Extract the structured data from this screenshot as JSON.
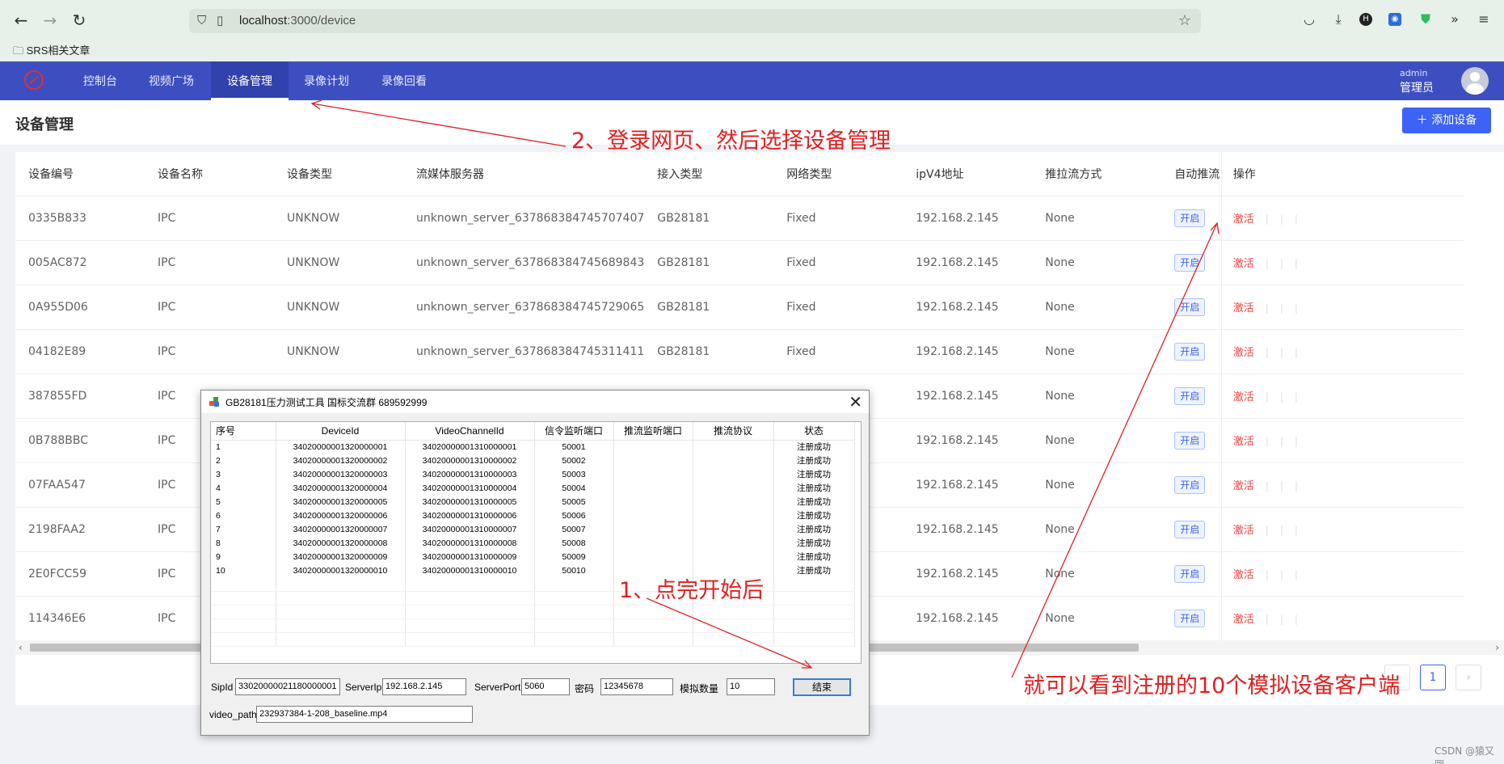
{
  "browser": {
    "url_host": "localhost",
    "url_path": ":3000/device",
    "bookmark": "SRS相关文章"
  },
  "app": {
    "menu": [
      "控制台",
      "视频广场",
      "设备管理",
      "录像计划",
      "录像回看"
    ],
    "active_menu": "设备管理",
    "user_name": "admin",
    "user_role": "管理员"
  },
  "page": {
    "title": "设备管理",
    "add_button": "添加设备"
  },
  "table": {
    "columns": [
      "设备编号",
      "设备名称",
      "设备类型",
      "流媒体服务器",
      "接入类型",
      "网络类型",
      "ipV4地址",
      "推拉流方式",
      "自动推流",
      "操作"
    ],
    "rows": [
      [
        "0335B833",
        "IPC",
        "UNKNOW",
        "unknown_server_637868384745707407",
        "GB28181",
        "Fixed",
        "192.168.2.145",
        "None",
        "开启",
        "激活"
      ],
      [
        "005AC872",
        "IPC",
        "UNKNOW",
        "unknown_server_637868384745689843",
        "GB28181",
        "Fixed",
        "192.168.2.145",
        "None",
        "开启",
        "激活"
      ],
      [
        "0A955D06",
        "IPC",
        "UNKNOW",
        "unknown_server_637868384745729065",
        "GB28181",
        "Fixed",
        "192.168.2.145",
        "None",
        "开启",
        "激活"
      ],
      [
        "04182E89",
        "IPC",
        "UNKNOW",
        "unknown_server_637868384745311411",
        "GB28181",
        "Fixed",
        "192.168.2.145",
        "None",
        "开启",
        "激活"
      ],
      [
        "387855FD",
        "IPC",
        "",
        "",
        "",
        "",
        "192.168.2.145",
        "None",
        "开启",
        "激活"
      ],
      [
        "0B788BBC",
        "IPC",
        "",
        "",
        "",
        "",
        "192.168.2.145",
        "None",
        "开启",
        "激活"
      ],
      [
        "07FAA547",
        "IPC",
        "",
        "",
        "",
        "",
        "192.168.2.145",
        "None",
        "开启",
        "激活"
      ],
      [
        "2198FAA2",
        "IPC",
        "",
        "",
        "",
        "",
        "192.168.2.145",
        "None",
        "开启",
        "激活"
      ],
      [
        "2E0FCC59",
        "IPC",
        "",
        "",
        "",
        "",
        "192.168.2.145",
        "None",
        "开启",
        "激活"
      ],
      [
        "114346E6",
        "IPC",
        "",
        "",
        "",
        "",
        "192.168.2.145",
        "None",
        "开启",
        "激活"
      ]
    ],
    "current_page": "1"
  },
  "dialog": {
    "title": "GB28181压力测试工具 国标交流群 689592999",
    "columns": [
      "序号",
      "DeviceId",
      "VideoChannelId",
      "信令监听端口",
      "推流监听端口",
      "推流协议",
      "状态"
    ],
    "rows": [
      [
        "1",
        "34020000001320000001",
        "34020000001310000001",
        "50001",
        "",
        "",
        "注册成功"
      ],
      [
        "2",
        "34020000001320000002",
        "34020000001310000002",
        "50002",
        "",
        "",
        "注册成功"
      ],
      [
        "3",
        "34020000001320000003",
        "34020000001310000003",
        "50003",
        "",
        "",
        "注册成功"
      ],
      [
        "4",
        "34020000001320000004",
        "34020000001310000004",
        "50004",
        "",
        "",
        "注册成功"
      ],
      [
        "5",
        "34020000001320000005",
        "34020000001310000005",
        "50005",
        "",
        "",
        "注册成功"
      ],
      [
        "6",
        "34020000001320000006",
        "34020000001310000006",
        "50006",
        "",
        "",
        "注册成功"
      ],
      [
        "7",
        "34020000001320000007",
        "34020000001310000007",
        "50007",
        "",
        "",
        "注册成功"
      ],
      [
        "8",
        "34020000001320000008",
        "34020000001310000008",
        "50008",
        "",
        "",
        "注册成功"
      ],
      [
        "9",
        "34020000001320000009",
        "34020000001310000009",
        "50009",
        "",
        "",
        "注册成功"
      ],
      [
        "10",
        "34020000001320000010",
        "34020000001310000010",
        "50010",
        "",
        "",
        "注册成功"
      ]
    ],
    "sipid_label": "SipId",
    "sipid_value": "33020000021180000001",
    "serverip_label": "ServerIp",
    "serverip_value": "192.168.2.145",
    "serverport_label": "ServerPort",
    "serverport_value": "5060",
    "password_label": "密码",
    "password_value": "12345678",
    "count_label": "模拟数量",
    "count_value": "10",
    "end_button": "结束",
    "videopath_label": "video_path",
    "videopath_value": "232937384-1-208_baseline.mp4"
  },
  "annotations": {
    "step2": "2、登录网页、然后选择设备管理",
    "step1": "1、点完开始后",
    "result": "就可以看到注册的10个模拟设备客户端"
  },
  "watermark": "CSDN @猿又圆",
  "colors": {
    "header_bg": "#3d4fc0",
    "primary": "#3c63f5",
    "annotation": "#e02020",
    "activate": "#f04040"
  }
}
